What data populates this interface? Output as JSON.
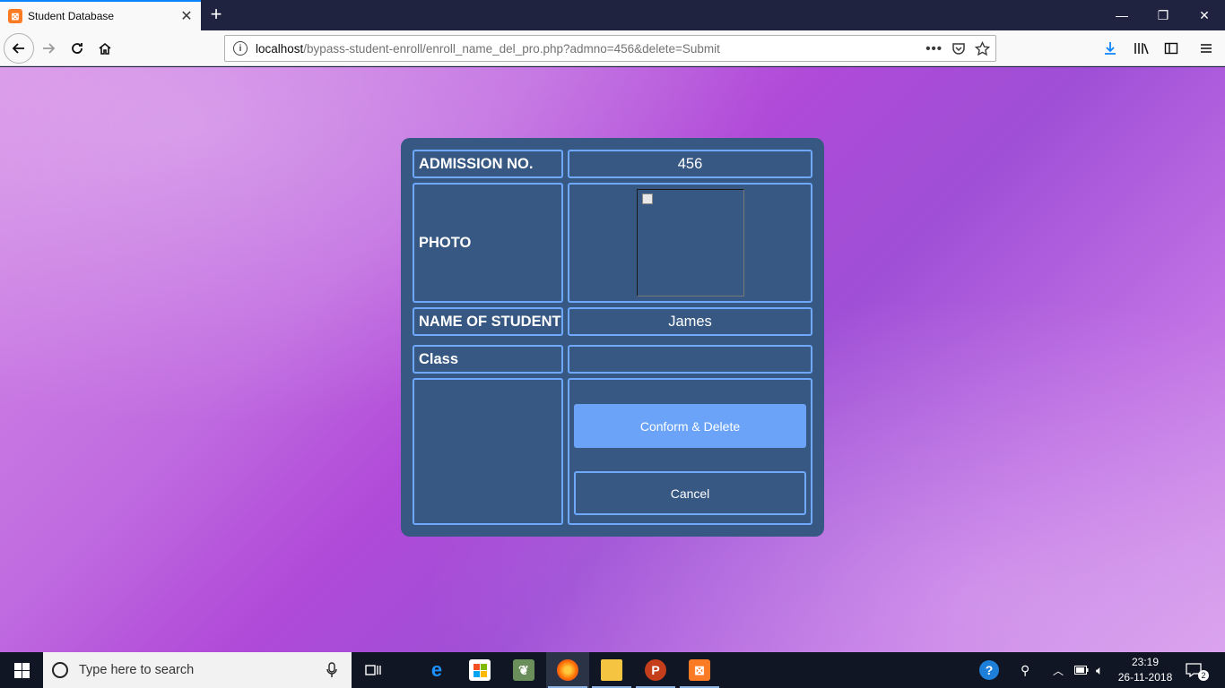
{
  "browser": {
    "tab_title": "Student Database",
    "tab_close": "✕",
    "new_tab": "+",
    "url_host": "localhost",
    "url_path": "/bypass-student-enroll/enroll_name_del_pro.php?admno=456&delete=Submit",
    "window_controls": {
      "minimize": "—",
      "restore": "❐",
      "close": "✕"
    }
  },
  "form": {
    "admission_label": "ADMISSION NO.",
    "admission_value": "456",
    "photo_label": "PHOTO",
    "name_label": "NAME OF STUDENT",
    "name_value": "James",
    "class_label": "Class",
    "class_value": "",
    "delete_button": "Conform & Delete",
    "cancel_button": "Cancel"
  },
  "taskbar": {
    "search_placeholder": "Type here to search",
    "time": "23:19",
    "date": "26-11-2018",
    "notification_count": "2"
  },
  "colors": {
    "panel_bg": "#365883",
    "cell_border": "#6ea8ff",
    "delete_button_bg": "#6aa3f7"
  }
}
